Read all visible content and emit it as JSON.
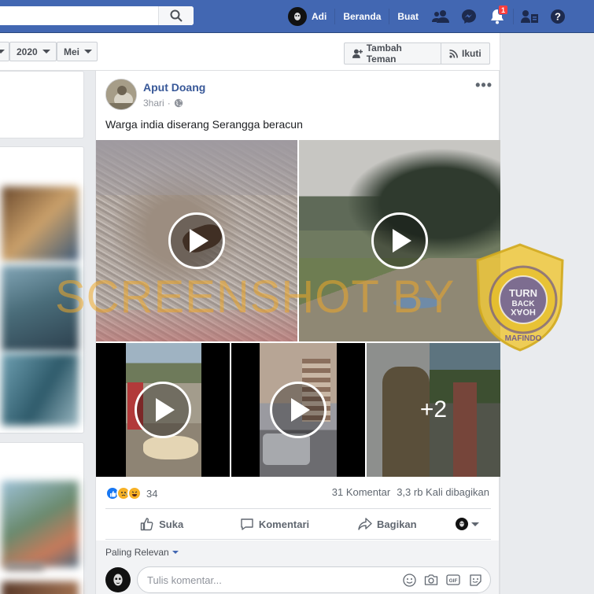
{
  "topbar": {
    "user_name": "Adi",
    "home_label": "Beranda",
    "create_label": "Buat",
    "notification_count": "1"
  },
  "filters": {
    "year_value": "2020",
    "month_value": "Mei",
    "add_friend_label": "Tambah Teman",
    "follow_label": "Ikuti"
  },
  "post": {
    "author": "Aput Doang",
    "time": "3hari",
    "text": "Warga india diserang Serangga beracun",
    "media_more": "+2",
    "reaction_count": "34",
    "comments": "31 Komentar",
    "shares": "3,3 rb Kali dibagikan",
    "actions": {
      "like": "Suka",
      "comment": "Komentari",
      "share": "Bagikan"
    },
    "sort_label": "Paling Relevan",
    "comment_placeholder": "Tulis komentar..."
  },
  "watermark": {
    "text": "SCREENSHOT BY",
    "badge_top": "MASYARAKAT ANTI FITNAH INDONESIA",
    "badge_logo": "TURN BACK HOAX",
    "badge_bottom": "MAFINDO"
  },
  "colors": {
    "brand_blue": "#4267b2",
    "link_blue": "#385898",
    "watermark_orange": "#eea828"
  }
}
